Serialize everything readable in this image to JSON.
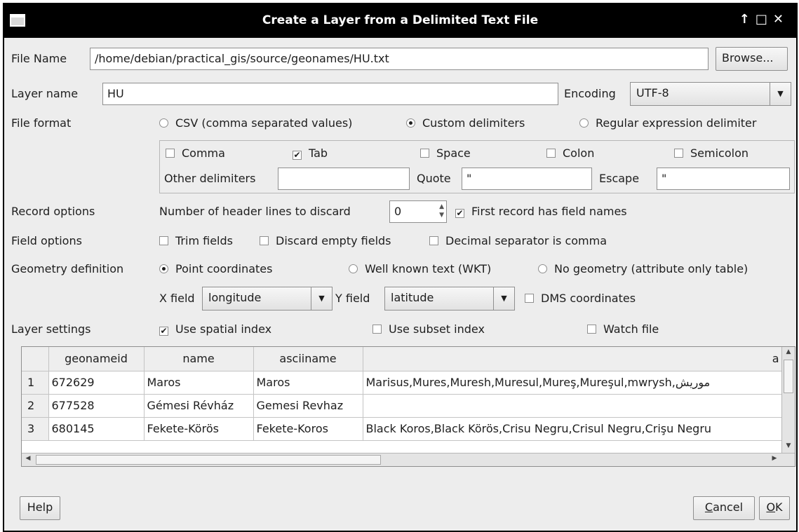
{
  "window": {
    "title": "Create a Layer from a Delimited Text File",
    "controls": [
      "↑",
      "□",
      "✕"
    ]
  },
  "file": {
    "label": "File Name",
    "value": "/home/debian/practical_gis/source/geonames/HU.txt",
    "browse": "Browse..."
  },
  "layer": {
    "label": "Layer name",
    "value": "HU",
    "encoding_label": "Encoding",
    "encoding_value": "UTF-8"
  },
  "format": {
    "label": "File format",
    "options": [
      "CSV (comma separated values)",
      "Custom delimiters",
      "Regular expression delimiter"
    ],
    "selected": "Custom delimiters"
  },
  "delimiters": {
    "comma": {
      "label": "Comma",
      "checked": false
    },
    "tab": {
      "label": "Tab",
      "checked": true
    },
    "space": {
      "label": "Space",
      "checked": false
    },
    "colon": {
      "label": "Colon",
      "checked": false
    },
    "semicolon": {
      "label": "Semicolon",
      "checked": false
    },
    "other_label": "Other delimiters",
    "other_value": "",
    "quote_label": "Quote",
    "quote_value": "\"",
    "escape_label": "Escape",
    "escape_value": "\""
  },
  "record": {
    "label": "Record options",
    "header_lines_label": "Number of header lines to discard",
    "header_lines_value": "0",
    "first_record": {
      "label": "First record has field names",
      "checked": true
    }
  },
  "field_options": {
    "label": "Field options",
    "trim": {
      "label": "Trim fields",
      "checked": false
    },
    "discard_empty": {
      "label": "Discard empty fields",
      "checked": false
    },
    "decimal_comma": {
      "label": "Decimal separator is comma",
      "checked": false
    }
  },
  "geometry": {
    "label": "Geometry definition",
    "options": [
      "Point coordinates",
      "Well known text (WKT)",
      "No geometry (attribute only table)"
    ],
    "selected": "Point coordinates",
    "x_label": "X field",
    "x_value": "longitude",
    "y_label": "Y field",
    "y_value": "latitude",
    "dms": {
      "label": "DMS coordinates",
      "checked": false
    }
  },
  "layer_settings": {
    "label": "Layer settings",
    "spatial_index": {
      "label": "Use spatial index",
      "checked": true
    },
    "subset_index": {
      "label": "Use subset index",
      "checked": false
    },
    "watch_file": {
      "label": "Watch file",
      "checked": false
    }
  },
  "preview": {
    "columns": [
      "",
      "geonameid",
      "name",
      "asciiname",
      "a"
    ],
    "rows": [
      [
        "1",
        "672629",
        "Maros",
        "Maros",
        "Marisus,Mures,Muresh,Muresul,Mureş,Mureşul,mwrysh,موريش"
      ],
      [
        "2",
        "677528",
        "Gémesi Révház",
        "Gemesi Revhaz",
        ""
      ],
      [
        "3",
        "680145",
        "Fekete-Körös",
        "Fekete-Koros",
        "Black Koros,Black Körös,Crisu Negru,Crisul Negru,Crişu Negru"
      ]
    ]
  },
  "buttons": {
    "help": "Help",
    "cancel_pre": "",
    "cancel_key": "C",
    "cancel_post": "ancel",
    "ok_key": "O",
    "ok_post": "K"
  }
}
